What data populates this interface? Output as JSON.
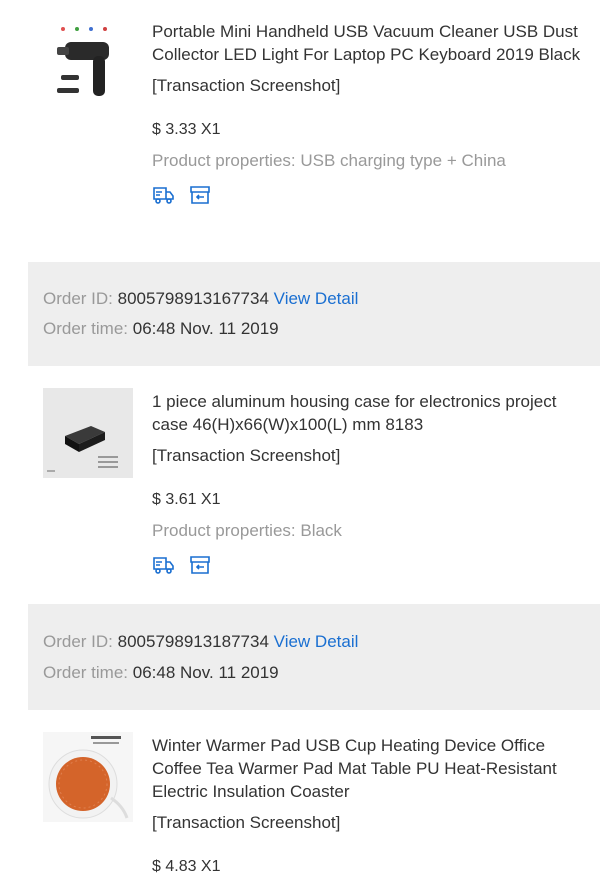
{
  "orders": [
    {
      "product": {
        "title": "Portable Mini Handheld USB Vacuum Cleaner USB Dust Collector LED Light For Laptop PC Keyboard 2019 Black",
        "transaction": "[Transaction Screenshot]",
        "price": "$ 3.33 X1",
        "properties": "Product properties: USB charging type + China",
        "image_icon": "handheld-vacuum-icon"
      },
      "order_id_label": "Order ID:",
      "order_id": "8005798913167734",
      "view_detail": "View Detail",
      "order_time_label": "Order time:",
      "order_time": "06:48 Nov. 11 2019"
    },
    {
      "product": {
        "title": "1 piece aluminum housing case for electronics project case 46(H)x66(W)x100(L) mm 8183",
        "transaction": "[Transaction Screenshot]",
        "price": "$ 3.61 X1",
        "properties": "Product properties: Black",
        "image_icon": "black-project-box-icon"
      },
      "order_id_label": "Order ID:",
      "order_id": "8005798913187734",
      "view_detail": "View Detail",
      "order_time_label": "Order time:",
      "order_time": "06:48 Nov. 11 2019"
    },
    {
      "product": {
        "title": "Winter Warmer Pad USB Cup Heating Device Office Coffee Tea Warmer Pad Mat Table PU Heat-Resistant Electric Insulation Coaster",
        "transaction": "[Transaction Screenshot]",
        "price": "$ 4.83 X1",
        "image_icon": "cup-warmer-pad-icon"
      }
    }
  ],
  "action_icons": [
    "shipping-truck-icon",
    "return-box-icon"
  ],
  "colors": {
    "link": "#1a6fd1",
    "muted": "#999999",
    "bar": "#eeeeee"
  }
}
